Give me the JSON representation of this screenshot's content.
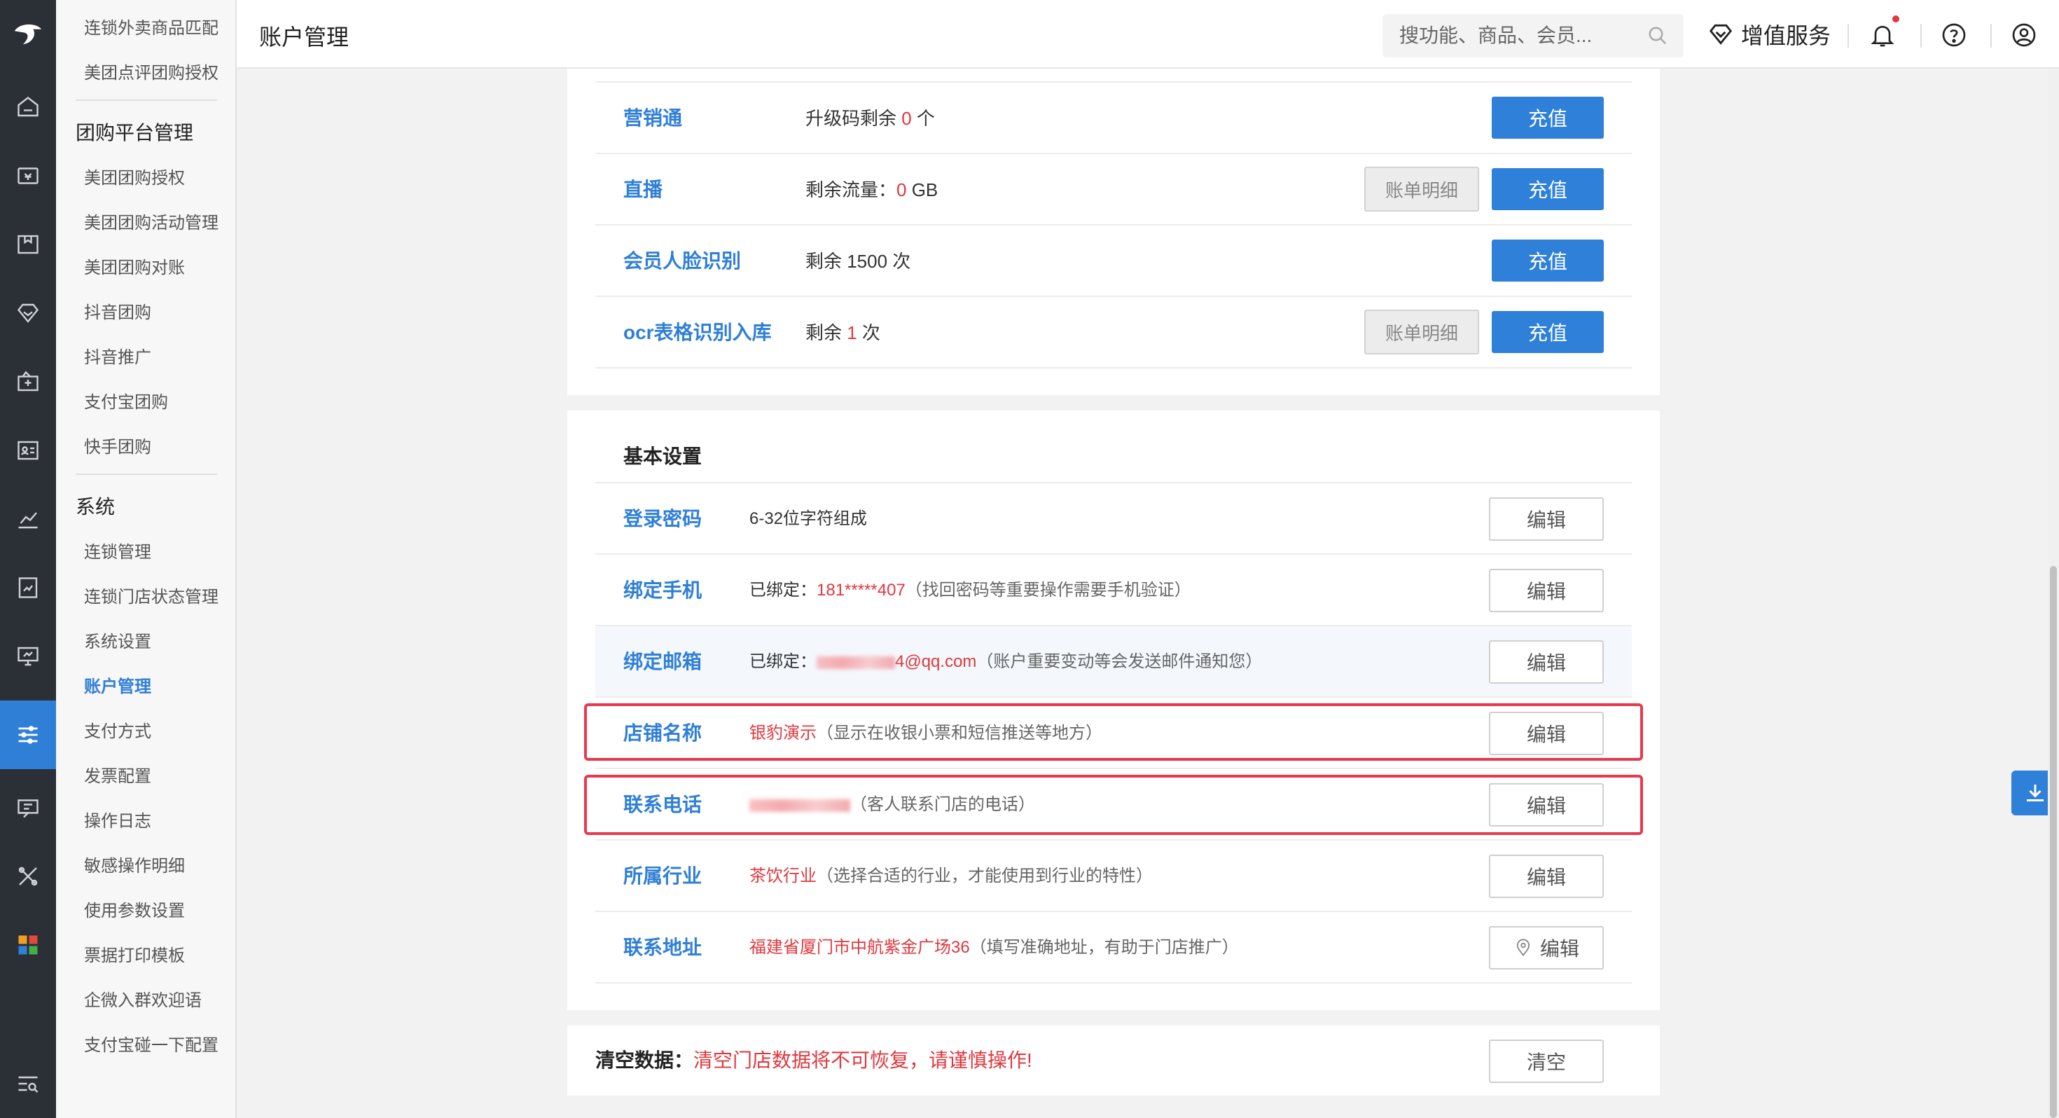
{
  "header": {
    "title": "账户管理",
    "search_placeholder": "搜功能、商品、会员...",
    "value_added_label": "增值服务"
  },
  "submenu": {
    "top_items": [
      "连锁外卖商品匹配",
      "美团点评团购授权"
    ],
    "group1_title": "团购平台管理",
    "group1_items": [
      "美团团购授权",
      "美团团购活动管理",
      "美团团购对账",
      "抖音团购",
      "抖音推广",
      "支付宝团购",
      "快手团购"
    ],
    "group2_title": "系统",
    "group2_items": [
      "连锁管理",
      "连锁门店状态管理",
      "系统设置",
      "账户管理",
      "支付方式",
      "发票配置",
      "操作日志",
      "敏感操作明细",
      "使用参数设置",
      "票据打印模板",
      "企微入群欢迎语",
      "支付宝碰一下配置"
    ],
    "active_item": "账户管理"
  },
  "services": [
    {
      "name": "营销通",
      "desc_prefix": "升级码剩余 ",
      "desc_value": "0",
      "desc_suffix": " 个",
      "bill": "",
      "recharge": "充值"
    },
    {
      "name": "直播",
      "desc_prefix": "剩余流量：",
      "desc_value": "0",
      "desc_suffix": " GB",
      "bill": "账单明细",
      "recharge": "充值"
    },
    {
      "name": "会员人脸识别",
      "desc_prefix": "剩余 1500 次",
      "desc_value": "",
      "desc_suffix": "",
      "bill": "",
      "recharge": "充值"
    },
    {
      "name": "ocr表格识别入库",
      "desc_prefix": "剩余 ",
      "desc_value": "1",
      "desc_suffix": " 次",
      "bill": "账单明细",
      "recharge": "充值"
    }
  ],
  "basic_settings": {
    "title": "基本设置",
    "edit_label": "编辑",
    "password": {
      "label": "登录密码",
      "desc": "6-32位字符组成"
    },
    "phone": {
      "label": "绑定手机",
      "prefix": "已绑定：",
      "value": "181*****407",
      "note": "（找回密码等重要操作需要手机验证）"
    },
    "email": {
      "label": "绑定邮箱",
      "prefix": "已绑定：",
      "value": "4@qq.com",
      "note": "（账户重要变动等会发送邮件通知您）"
    },
    "store_name": {
      "label": "店铺名称",
      "value": "银豹演示",
      "note": "（显示在收银小票和短信推送等地方）"
    },
    "contact_phone": {
      "label": "联系电话",
      "note": "（客人联系门店的电话）"
    },
    "industry": {
      "label": "所属行业",
      "value": "茶饮行业",
      "note": "（选择合适的行业，才能使用到行业的特性）"
    },
    "address": {
      "label": "联系地址",
      "value": "福建省厦门市中航紫金广场36",
      "note": "（填写准确地址，有助于门店推广）"
    }
  },
  "clear_data": {
    "label": "清空数据：",
    "warning": "清空门店数据将不可恢复，请谨慎操作!",
    "button": "清空"
  },
  "colors": {
    "accent": "#2f80d8",
    "warning": "#e0383e",
    "highlight_box": "#e8384f",
    "rail": "#2b2f36"
  }
}
